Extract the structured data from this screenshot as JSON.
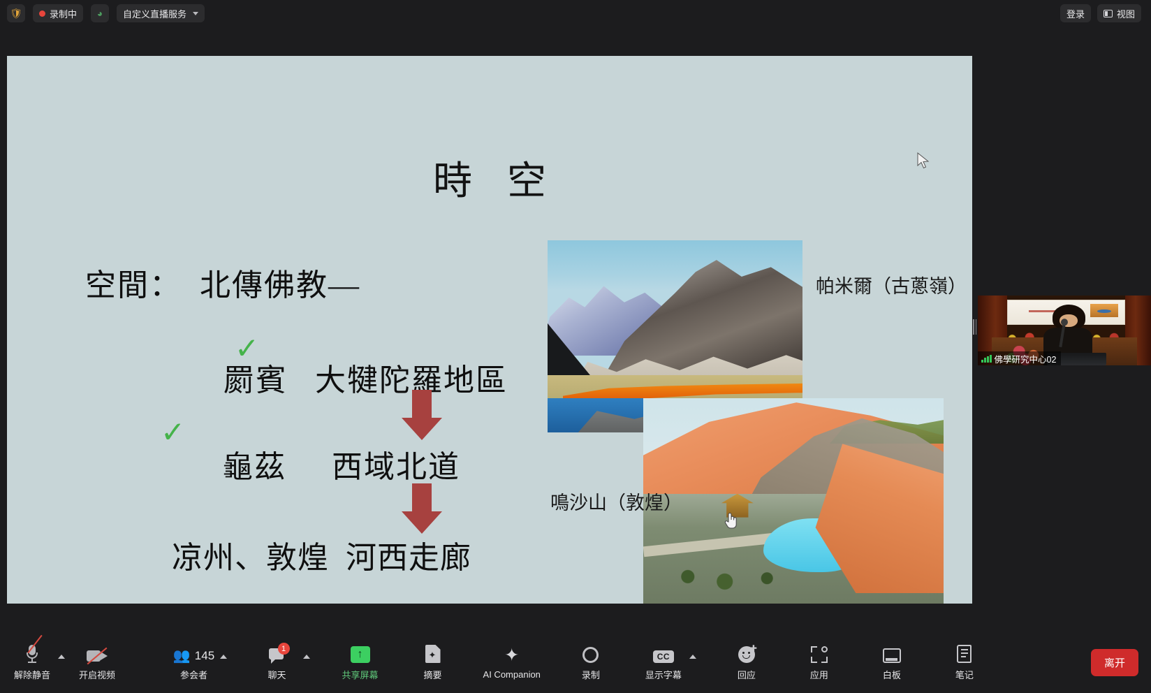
{
  "topbar": {
    "security_icon": "shield-icon",
    "recording_label": "录制中",
    "livestream_icon": "broadcast-icon",
    "livestream_label": "自定义直播服务",
    "login_label": "登录",
    "view_label": "视图",
    "view_icon": "layout-view-icon"
  },
  "slide": {
    "title": "時  空",
    "bullets": [
      "空間：  北傳佛教—",
      "罽賓   大犍陀羅地區",
      "龜茲     西域北道",
      "凉州、敦煌  河西走廊"
    ],
    "checkmarks": [
      "✓",
      "✓"
    ],
    "captions": {
      "pamir": "帕米爾（古蔥嶺）",
      "dunhuang": "鳴沙山（敦煌）"
    },
    "photos": {
      "pamir_alt": "pamir-mountains-photo",
      "dunhuang_alt": "mingsha-dune-crescent-lake-photo"
    },
    "background_color": "#c7d5d7",
    "arrow_color": "#a7413f",
    "check_color": "#45b34a"
  },
  "thumbnail": {
    "participant_name": "佛學研究中心02",
    "signal_icon": "signal-bars-icon"
  },
  "toolbar": {
    "items": [
      {
        "name": "unmute",
        "label": "解除静音",
        "icon": "microphone-muted-icon",
        "has_chevron": true,
        "green": false
      },
      {
        "name": "start-video",
        "label": "开启视频",
        "icon": "camera-off-icon",
        "has_chevron": false,
        "green": false
      },
      {
        "name": "participants",
        "label": "参会者",
        "icon": "people-icon",
        "has_chevron": true,
        "green": false,
        "count": "145"
      },
      {
        "name": "chat",
        "label": "聊天",
        "icon": "chat-bubble-icon",
        "has_chevron": true,
        "green": false,
        "badge": "1"
      },
      {
        "name": "share-screen",
        "label": "共享屏幕",
        "icon": "share-screen-icon",
        "has_chevron": false,
        "green": true
      },
      {
        "name": "summary",
        "label": "摘要",
        "icon": "summary-doc-icon",
        "has_chevron": false,
        "green": false
      },
      {
        "name": "ai-companion",
        "label": "AI Companion",
        "icon": "sparkle-icon",
        "has_chevron": false,
        "green": false
      },
      {
        "name": "record",
        "label": "录制",
        "icon": "record-circle-icon",
        "has_chevron": false,
        "green": false
      },
      {
        "name": "captions",
        "label": "显示字幕",
        "icon": "closed-caption-icon",
        "has_chevron": true,
        "green": false
      },
      {
        "name": "reactions",
        "label": "回应",
        "icon": "emoji-reaction-icon",
        "has_chevron": false,
        "green": false
      },
      {
        "name": "apps",
        "label": "应用",
        "icon": "apps-icon",
        "has_chevron": false,
        "green": false
      },
      {
        "name": "whiteboard",
        "label": "白板",
        "icon": "whiteboard-icon",
        "has_chevron": false,
        "green": false
      },
      {
        "name": "notes",
        "label": "笔记",
        "icon": "notes-icon",
        "has_chevron": false,
        "green": false
      }
    ],
    "leave_label": "离开",
    "leave_color": "#cf2b2b"
  },
  "cursors": {
    "arrow": "mouse-arrow-cursor",
    "hand": "pointing-hand-cursor"
  }
}
